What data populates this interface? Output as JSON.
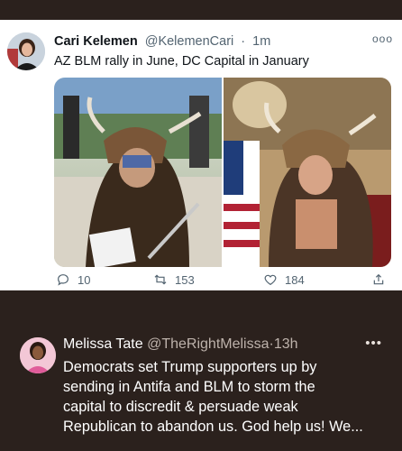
{
  "tweet1": {
    "name": "Cari Kelemen",
    "handle": "@KelemenCari",
    "separator": "·",
    "time": "1m",
    "more_icon": "ooo",
    "text": "AZ BLM rally in June, DC Capital in January",
    "actions": {
      "reply_count": "10",
      "retweet_count": "153",
      "like_count": "184"
    }
  },
  "tweet2": {
    "name": "Melissa Tate",
    "handle": "@TheRightMelissa",
    "separator": "·",
    "time": "13h",
    "more_icon": "•••",
    "lines": [
      "Democrats set Trump supporters up by",
      "sending in Antifa and BLM to storm the",
      "capital to discredit & persuade weak",
      "Republican to abandon us. God help us! We..."
    ]
  },
  "icons": [
    "reply-icon",
    "retweet-icon",
    "like-icon",
    "share-icon"
  ]
}
